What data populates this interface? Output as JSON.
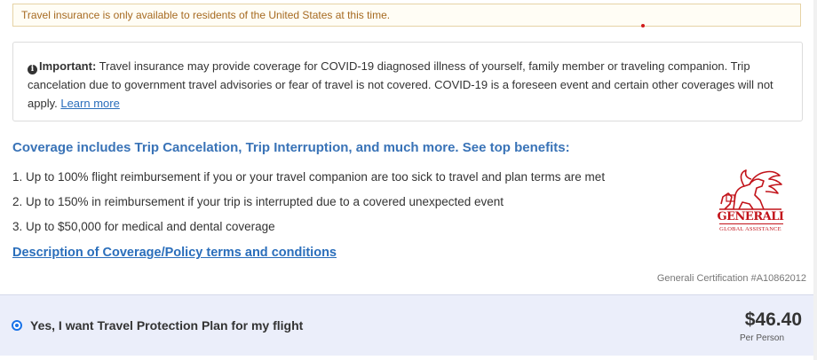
{
  "notice": {
    "text": "Travel insurance is only available to residents of the United States at this time."
  },
  "important": {
    "label": "Important:",
    "text": " Travel insurance may provide coverage for COVID-19 diagnosed illness of yourself, family member or traveling companion. Trip cancelation due to government travel advisories or fear of travel is not covered. COVID-19 is a foreseen event and certain other coverages will not apply. ",
    "link": "Learn more"
  },
  "coverage": {
    "heading": "Coverage includes Trip Cancelation, Trip Interruption, and much more. See top benefits:",
    "benefits": [
      "1. Up to 100% flight reimbursement if you or your travel companion are too sick to travel and plan terms are met",
      "2. Up to 150% in reimbursement if your trip is interrupted due to a covered unexpected event",
      "3. Up to $50,000 for medical and dental coverage"
    ],
    "terms_link": "Description of Coverage/Policy terms and conditions"
  },
  "logo": {
    "name": "GENERALI",
    "sub": "GLOBAL ASSISTANCE",
    "color": "#c2131a"
  },
  "certification": "Generali Certification #A10862012",
  "plan": {
    "label": "Yes, I want Travel Protection Plan for my flight",
    "selected": true,
    "price": "$46.40",
    "price_unit": "Per Person"
  },
  "colors": {
    "accent": "#3973b7",
    "link": "#2a6ebb",
    "notice_text": "#a66a21",
    "plan_bg": "#ebeefa"
  }
}
